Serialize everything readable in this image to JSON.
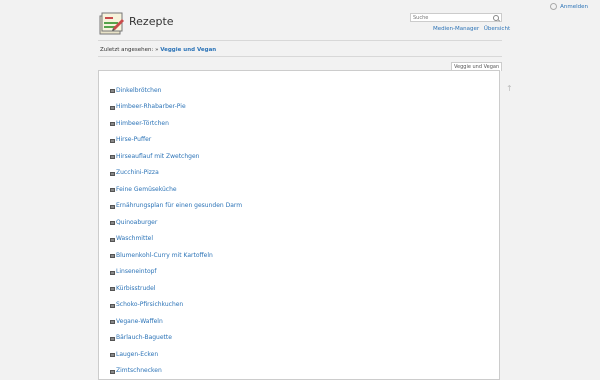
{
  "header": {
    "title": "Rezepte",
    "login_label": "Anmelden",
    "search_placeholder": "Suche",
    "tools": [
      "Medien-Manager",
      "Übersicht"
    ]
  },
  "breadcrumb": {
    "label": "Zuletzt angesehen:",
    "separator": "»",
    "current": "Veggie und Vegan"
  },
  "page_tab": "Veggie und Vegan",
  "recipes": [
    "Dinkelbrötchen",
    "Himbeer-Rhabarber-Pie",
    "Himbeer-Törtchen",
    "Hirse-Puffer",
    "Hirseauflauf mit Zwetchgen",
    "Zucchini-Pizza",
    "Feine Gemüseküche",
    "Ernährungsplan für einen gesunden Darm",
    "Quinoaburger",
    "Waschmittel",
    "Blumenkohl-Curry mit Kartoffeln",
    "Linseneintopf",
    "Kürbisstrudel",
    "Schoko-Pfirsichkuchen",
    "Vegane-Waffeln",
    "Bärlauch-Baguette",
    "Laugen-Ecken",
    "Zimtschnecken"
  ],
  "icons": {
    "back_to_top": "arrow-up-icon",
    "page": "page-icon",
    "logo": "recipe-book-logo"
  },
  "colors": {
    "link": "#2b73b7",
    "background": "#f2f2f2"
  }
}
